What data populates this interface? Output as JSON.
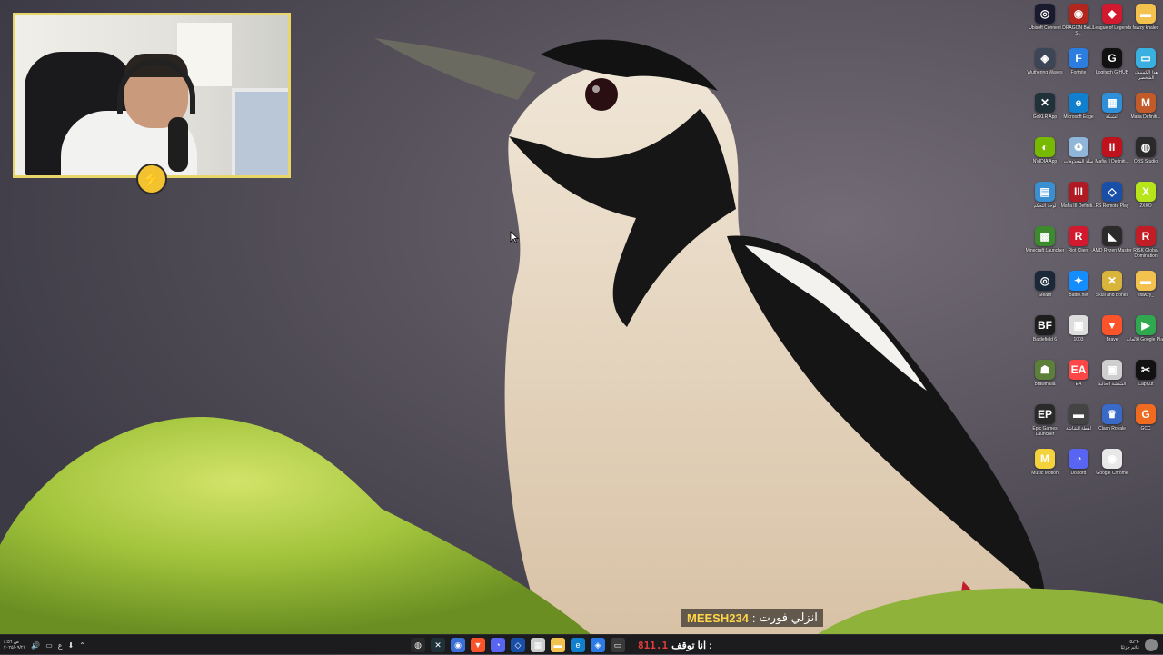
{
  "overlay_chat": {
    "username": "MEESH234",
    "separator": ":",
    "message": "انزلي فورت"
  },
  "webcam": {
    "logo_letter": "⚡"
  },
  "desktop_icons": [
    {
      "label": "Ubisoft Connect",
      "icon": "ubisoft-icon",
      "color": "#1a1a2e",
      "glyph": "◎"
    },
    {
      "label": "DRAGON BALL S...",
      "icon": "dragonball-icon",
      "color": "#b3261e",
      "glyph": "◉"
    },
    {
      "label": "League of Legends",
      "icon": "league-icon",
      "color": "#d3192d",
      "glyph": "◆"
    },
    {
      "label": "fawzy khaled",
      "icon": "folder-icon",
      "color": "#f2c14e",
      "glyph": "▬"
    },
    {
      "label": "Wuthering Waves",
      "icon": "wuthering-icon",
      "color": "#3c4656",
      "glyph": "◈"
    },
    {
      "label": "Fortnite",
      "icon": "fortnite-icon",
      "color": "#2b7de0",
      "glyph": "F"
    },
    {
      "label": "Logitech G HUB",
      "icon": "logitech-icon",
      "color": "#111111",
      "glyph": "G"
    },
    {
      "label": "هذا الكمبيوتر الشخصي",
      "icon": "this-pc-icon",
      "color": "#3ab0e0",
      "glyph": "▭"
    },
    {
      "label": "GoXLR App",
      "icon": "goxlr-icon",
      "color": "#20313a",
      "glyph": "✕"
    },
    {
      "label": "Microsoft Edge",
      "icon": "edge-icon",
      "color": "#0f7fce",
      "glyph": "e"
    },
    {
      "label": "الشبكة",
      "icon": "network-icon",
      "color": "#2f8fd8",
      "glyph": "▦"
    },
    {
      "label": "Mafia Definiti...",
      "icon": "mafia-icon",
      "color": "#c25a2a",
      "glyph": "M"
    },
    {
      "label": "NVIDIA App",
      "icon": "nvidia-icon",
      "color": "#76b900",
      "glyph": "◐"
    },
    {
      "label": "سلة المحذوفات",
      "icon": "recycle-bin-icon",
      "color": "#8fb5d8",
      "glyph": "♻"
    },
    {
      "label": "Mafia II Definiti...",
      "icon": "mafia2-icon",
      "color": "#c0121c",
      "glyph": "II"
    },
    {
      "label": "OBS Studio",
      "icon": "obs-icon",
      "color": "#2a2a2a",
      "glyph": "◍"
    },
    {
      "label": "لوحة التحكم",
      "icon": "control-panel-icon",
      "color": "#3a8fd0",
      "glyph": "▤"
    },
    {
      "label": "Mafia III Definiti...",
      "icon": "mafia3-icon",
      "color": "#b01a22",
      "glyph": "III"
    },
    {
      "label": "PS Remote Play",
      "icon": "ps-remote-icon",
      "color": "#1a4fa8",
      "glyph": "◇"
    },
    {
      "label": "2XKO",
      "icon": "2xko-icon",
      "color": "#b6e51a",
      "glyph": "X"
    },
    {
      "label": "Minecraft Launcher",
      "icon": "minecraft-icon",
      "color": "#3e8b2f",
      "glyph": "▩"
    },
    {
      "label": "Riot Client",
      "icon": "riot-icon",
      "color": "#d3192d",
      "glyph": "R"
    },
    {
      "label": "AMD Ryzen Master",
      "icon": "amd-icon",
      "color": "#2b2b2b",
      "glyph": "◣"
    },
    {
      "label": "RISK Global Domination",
      "icon": "risk-icon",
      "color": "#c21d24",
      "glyph": "R"
    },
    {
      "label": "Steam",
      "icon": "steam-icon",
      "color": "#1b2838",
      "glyph": "◎"
    },
    {
      "label": "Battle.net",
      "icon": "battlenet-icon",
      "color": "#148eff",
      "glyph": "✦"
    },
    {
      "label": "Skull and Bones",
      "icon": "skull-bones-icon",
      "color": "#d8b43a",
      "glyph": "✕"
    },
    {
      "label": "sfawzy_",
      "icon": "folder-icon",
      "color": "#f2c14e",
      "glyph": "▬"
    },
    {
      "label": "Battlefield 6",
      "icon": "battlefield-icon",
      "color": "#1d1d1d",
      "glyph": "BF"
    },
    {
      "label": "1003",
      "icon": "image-file-icon",
      "color": "#dddddd",
      "glyph": "▣"
    },
    {
      "label": "Brave",
      "icon": "brave-icon",
      "color": "#fb542b",
      "glyph": "▼"
    },
    {
      "label": "الألعاب Google Play",
      "icon": "google-play-games-icon",
      "color": "#2fa84f",
      "glyph": "▶"
    },
    {
      "label": "Brawlhalla",
      "icon": "brawlhalla-icon",
      "color": "#5c7f3a",
      "glyph": "☗"
    },
    {
      "label": "EA",
      "icon": "ea-icon",
      "color": "#ff4747",
      "glyph": "EA"
    },
    {
      "label": "الشاشة الحالية",
      "icon": "screenshot-file-icon",
      "color": "#cfcfcf",
      "glyph": "▣"
    },
    {
      "label": "CapCut",
      "icon": "capcut-icon",
      "color": "#111111",
      "glyph": "✂"
    },
    {
      "label": "Epic Games Launcher",
      "icon": "epic-icon",
      "color": "#2a2a2a",
      "glyph": "EP"
    },
    {
      "label": "لقطة الشاشة",
      "icon": "screenshot2-file-icon",
      "color": "#444444",
      "glyph": "▬"
    },
    {
      "label": "Clash Royale",
      "icon": "clash-royale-icon",
      "color": "#3a6ac8",
      "glyph": "♛"
    },
    {
      "label": "GCC",
      "icon": "gcc-icon",
      "color": "#f06a1f",
      "glyph": "G"
    },
    {
      "label": "Music Motion",
      "icon": "music-motion-icon",
      "color": "#f3d23c",
      "glyph": "M"
    },
    {
      "label": "Discord",
      "icon": "discord-icon",
      "color": "#5865f2",
      "glyph": "◔"
    },
    {
      "label": "Google Chrome",
      "icon": "chrome-icon",
      "color": "#e8e8e8",
      "glyph": "◉"
    }
  ],
  "taskbar": {
    "left_tray": [
      "ص ٤:٥٦",
      "٢٠٢٥/٠٩/٢٧"
    ],
    "input_lang": "ع",
    "apps": [
      {
        "icon": "obs-taskbar-icon",
        "color": "#2a2a2a",
        "glyph": "◍"
      },
      {
        "icon": "goxlr-taskbar-icon",
        "color": "#20313a",
        "glyph": "✕"
      },
      {
        "icon": "chrome-taskbar-icon",
        "color": "#3a6fd8",
        "glyph": "◉"
      },
      {
        "icon": "brave-taskbar-icon",
        "color": "#fb542b",
        "glyph": "▼"
      },
      {
        "icon": "discord-taskbar-icon",
        "color": "#5865f2",
        "glyph": "◔"
      },
      {
        "icon": "ps-taskbar-icon",
        "color": "#1a4fa8",
        "glyph": "◇"
      },
      {
        "icon": "calendar-taskbar-icon",
        "color": "#cccccc",
        "glyph": "▦"
      },
      {
        "icon": "file-explorer-taskbar-icon",
        "color": "#f2c14e",
        "glyph": "▬"
      },
      {
        "icon": "edge-taskbar-icon",
        "color": "#0f7fce",
        "glyph": "e"
      },
      {
        "icon": "store-taskbar-icon",
        "color": "#2c7be5",
        "glyph": "◈"
      },
      {
        "icon": "terminal-taskbar-icon",
        "color": "#3a3a3a",
        "glyph": "▭"
      }
    ],
    "now_playing_label": "انا توقف :",
    "now_playing_count": "811.1",
    "weather_temp": "82°F",
    "weather_desc": "غائم جزئيًا"
  }
}
